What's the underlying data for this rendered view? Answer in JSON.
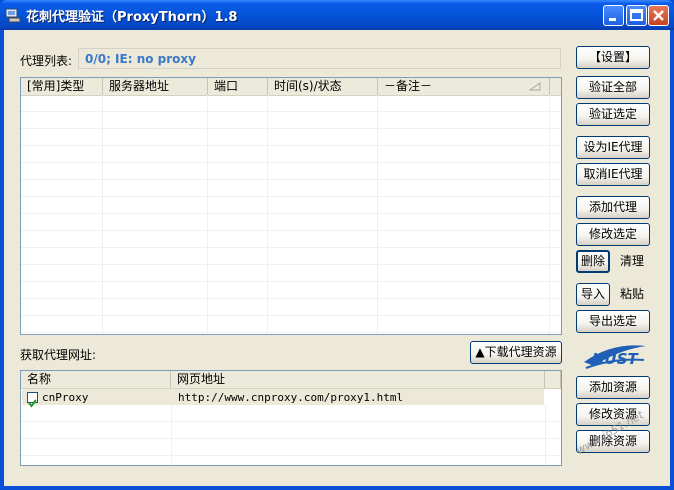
{
  "window": {
    "title": "花刺代理验证（ProxyThorn）1.8",
    "title_color": "#ffffff",
    "titlebar_color": "#0553d8"
  },
  "proxy_list": {
    "label": "代理列表:",
    "status": "0/0;   IE: no proxy",
    "columns": [
      "[常用]类型",
      "服务器地址",
      "端口",
      "时间(s)/状态",
      "－备注－"
    ],
    "rows": []
  },
  "buttons": {
    "settings": "【设置】",
    "verify_all": "验证全部",
    "verify_selected": "验证选定",
    "set_ie_proxy": "设为IE代理",
    "cancel_ie_proxy": "取消IE代理",
    "add_proxy": "添加代理",
    "edit_selected": "修改选定",
    "delete": "删除",
    "clear": "清理",
    "import": "导入",
    "paste": "粘贴",
    "export_selected": "导出选定",
    "download_resources": "▲下载代理资源",
    "add_resource": "添加资源",
    "edit_resource": "修改资源",
    "delete_resource": "删除资源"
  },
  "source_list": {
    "label": "获取代理网址:",
    "columns": [
      "名称",
      "网页地址"
    ],
    "rows": [
      {
        "checked": true,
        "name": "cnProxy",
        "url": "http://www.cnproxy.com/proxy1.html"
      }
    ]
  },
  "watermark": "www.jb51.net",
  "logo_color": "#1f5fb8"
}
